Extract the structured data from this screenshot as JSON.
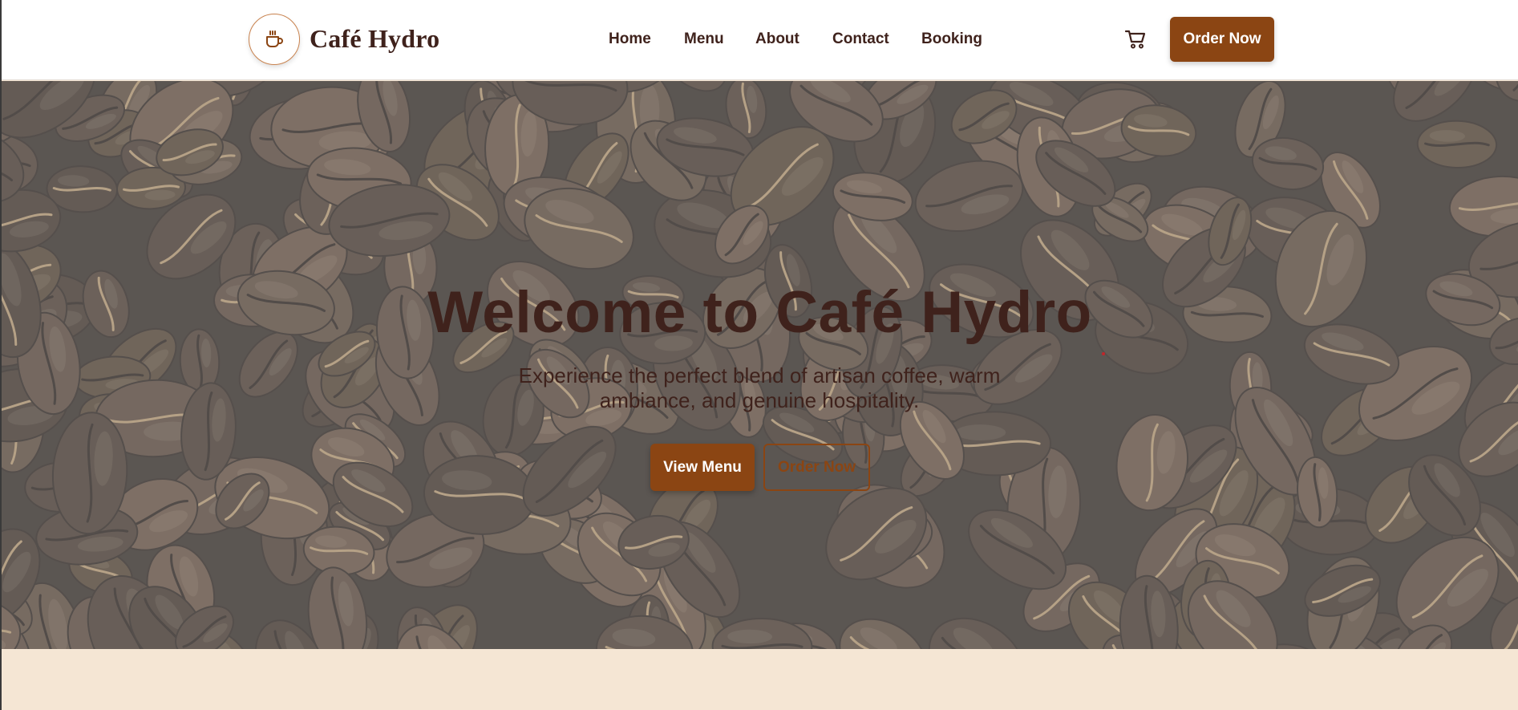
{
  "header": {
    "brand_name": "Café Hydro",
    "logo_icon": "coffee-cup-icon",
    "nav": [
      {
        "label": "Home"
      },
      {
        "label": "Menu"
      },
      {
        "label": "About"
      },
      {
        "label": "Contact"
      },
      {
        "label": "Booking"
      }
    ],
    "cart_icon": "shopping-cart-icon",
    "order_button_label": "Order Now"
  },
  "hero": {
    "title": "Welcome to Café Hydro",
    "subtitle": "Experience the perfect blend of artisan coffee, warm ambiance, and genuine hospitality.",
    "primary_button_label": "View Menu",
    "secondary_button_label": "Order Now",
    "background_image": "coffee-beans-photo"
  },
  "colors": {
    "accent": "#8b4513",
    "text_dark": "#3f221c",
    "header_bg": "#ffffff",
    "section_bg": "#f5e6d4",
    "logo_border": "#c9834f"
  }
}
